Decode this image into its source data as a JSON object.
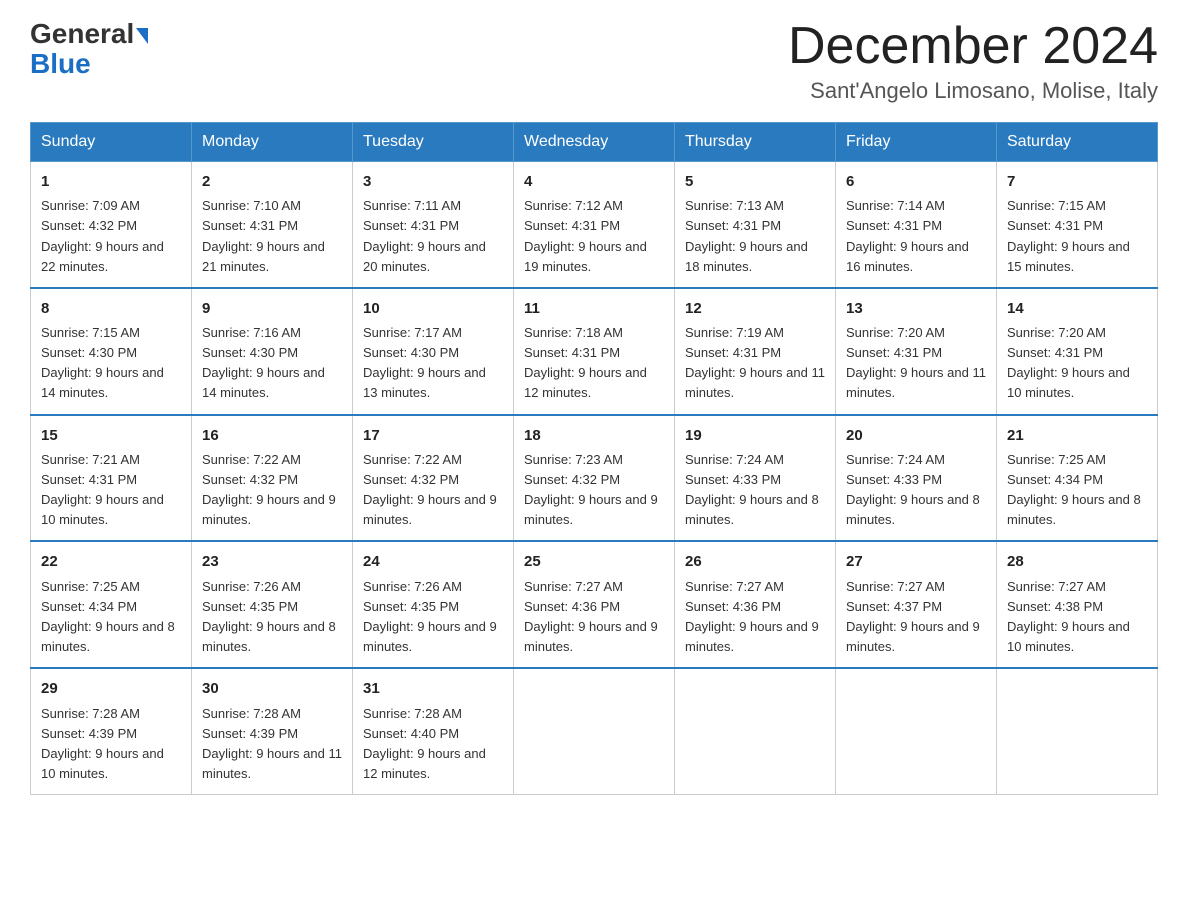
{
  "header": {
    "logo_line1": "General",
    "logo_line2": "Blue",
    "month": "December 2024",
    "location": "Sant'Angelo Limosano, Molise, Italy"
  },
  "columns": [
    "Sunday",
    "Monday",
    "Tuesday",
    "Wednesday",
    "Thursday",
    "Friday",
    "Saturday"
  ],
  "weeks": [
    [
      {
        "day": "1",
        "sunrise": "Sunrise: 7:09 AM",
        "sunset": "Sunset: 4:32 PM",
        "daylight": "Daylight: 9 hours and 22 minutes."
      },
      {
        "day": "2",
        "sunrise": "Sunrise: 7:10 AM",
        "sunset": "Sunset: 4:31 PM",
        "daylight": "Daylight: 9 hours and 21 minutes."
      },
      {
        "day": "3",
        "sunrise": "Sunrise: 7:11 AM",
        "sunset": "Sunset: 4:31 PM",
        "daylight": "Daylight: 9 hours and 20 minutes."
      },
      {
        "day": "4",
        "sunrise": "Sunrise: 7:12 AM",
        "sunset": "Sunset: 4:31 PM",
        "daylight": "Daylight: 9 hours and 19 minutes."
      },
      {
        "day": "5",
        "sunrise": "Sunrise: 7:13 AM",
        "sunset": "Sunset: 4:31 PM",
        "daylight": "Daylight: 9 hours and 18 minutes."
      },
      {
        "day": "6",
        "sunrise": "Sunrise: 7:14 AM",
        "sunset": "Sunset: 4:31 PM",
        "daylight": "Daylight: 9 hours and 16 minutes."
      },
      {
        "day": "7",
        "sunrise": "Sunrise: 7:15 AM",
        "sunset": "Sunset: 4:31 PM",
        "daylight": "Daylight: 9 hours and 15 minutes."
      }
    ],
    [
      {
        "day": "8",
        "sunrise": "Sunrise: 7:15 AM",
        "sunset": "Sunset: 4:30 PM",
        "daylight": "Daylight: 9 hours and 14 minutes."
      },
      {
        "day": "9",
        "sunrise": "Sunrise: 7:16 AM",
        "sunset": "Sunset: 4:30 PM",
        "daylight": "Daylight: 9 hours and 14 minutes."
      },
      {
        "day": "10",
        "sunrise": "Sunrise: 7:17 AM",
        "sunset": "Sunset: 4:30 PM",
        "daylight": "Daylight: 9 hours and 13 minutes."
      },
      {
        "day": "11",
        "sunrise": "Sunrise: 7:18 AM",
        "sunset": "Sunset: 4:31 PM",
        "daylight": "Daylight: 9 hours and 12 minutes."
      },
      {
        "day": "12",
        "sunrise": "Sunrise: 7:19 AM",
        "sunset": "Sunset: 4:31 PM",
        "daylight": "Daylight: 9 hours and 11 minutes."
      },
      {
        "day": "13",
        "sunrise": "Sunrise: 7:20 AM",
        "sunset": "Sunset: 4:31 PM",
        "daylight": "Daylight: 9 hours and 11 minutes."
      },
      {
        "day": "14",
        "sunrise": "Sunrise: 7:20 AM",
        "sunset": "Sunset: 4:31 PM",
        "daylight": "Daylight: 9 hours and 10 minutes."
      }
    ],
    [
      {
        "day": "15",
        "sunrise": "Sunrise: 7:21 AM",
        "sunset": "Sunset: 4:31 PM",
        "daylight": "Daylight: 9 hours and 10 minutes."
      },
      {
        "day": "16",
        "sunrise": "Sunrise: 7:22 AM",
        "sunset": "Sunset: 4:32 PM",
        "daylight": "Daylight: 9 hours and 9 minutes."
      },
      {
        "day": "17",
        "sunrise": "Sunrise: 7:22 AM",
        "sunset": "Sunset: 4:32 PM",
        "daylight": "Daylight: 9 hours and 9 minutes."
      },
      {
        "day": "18",
        "sunrise": "Sunrise: 7:23 AM",
        "sunset": "Sunset: 4:32 PM",
        "daylight": "Daylight: 9 hours and 9 minutes."
      },
      {
        "day": "19",
        "sunrise": "Sunrise: 7:24 AM",
        "sunset": "Sunset: 4:33 PM",
        "daylight": "Daylight: 9 hours and 8 minutes."
      },
      {
        "day": "20",
        "sunrise": "Sunrise: 7:24 AM",
        "sunset": "Sunset: 4:33 PM",
        "daylight": "Daylight: 9 hours and 8 minutes."
      },
      {
        "day": "21",
        "sunrise": "Sunrise: 7:25 AM",
        "sunset": "Sunset: 4:34 PM",
        "daylight": "Daylight: 9 hours and 8 minutes."
      }
    ],
    [
      {
        "day": "22",
        "sunrise": "Sunrise: 7:25 AM",
        "sunset": "Sunset: 4:34 PM",
        "daylight": "Daylight: 9 hours and 8 minutes."
      },
      {
        "day": "23",
        "sunrise": "Sunrise: 7:26 AM",
        "sunset": "Sunset: 4:35 PM",
        "daylight": "Daylight: 9 hours and 8 minutes."
      },
      {
        "day": "24",
        "sunrise": "Sunrise: 7:26 AM",
        "sunset": "Sunset: 4:35 PM",
        "daylight": "Daylight: 9 hours and 9 minutes."
      },
      {
        "day": "25",
        "sunrise": "Sunrise: 7:27 AM",
        "sunset": "Sunset: 4:36 PM",
        "daylight": "Daylight: 9 hours and 9 minutes."
      },
      {
        "day": "26",
        "sunrise": "Sunrise: 7:27 AM",
        "sunset": "Sunset: 4:36 PM",
        "daylight": "Daylight: 9 hours and 9 minutes."
      },
      {
        "day": "27",
        "sunrise": "Sunrise: 7:27 AM",
        "sunset": "Sunset: 4:37 PM",
        "daylight": "Daylight: 9 hours and 9 minutes."
      },
      {
        "day": "28",
        "sunrise": "Sunrise: 7:27 AM",
        "sunset": "Sunset: 4:38 PM",
        "daylight": "Daylight: 9 hours and 10 minutes."
      }
    ],
    [
      {
        "day": "29",
        "sunrise": "Sunrise: 7:28 AM",
        "sunset": "Sunset: 4:39 PM",
        "daylight": "Daylight: 9 hours and 10 minutes."
      },
      {
        "day": "30",
        "sunrise": "Sunrise: 7:28 AM",
        "sunset": "Sunset: 4:39 PM",
        "daylight": "Daylight: 9 hours and 11 minutes."
      },
      {
        "day": "31",
        "sunrise": "Sunrise: 7:28 AM",
        "sunset": "Sunset: 4:40 PM",
        "daylight": "Daylight: 9 hours and 12 minutes."
      },
      null,
      null,
      null,
      null
    ]
  ]
}
